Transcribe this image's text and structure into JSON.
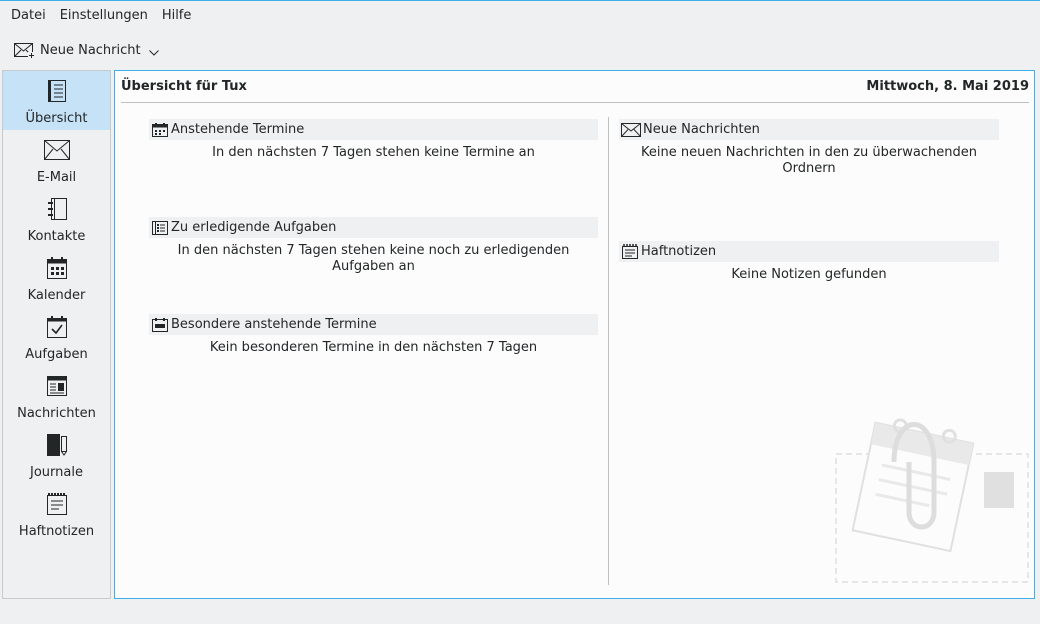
{
  "menubar": {
    "items": [
      "Datei",
      "Einstellungen",
      "Hilfe"
    ]
  },
  "toolbar": {
    "new_message": {
      "label": "Neue Nachricht",
      "icon": "mail-new-icon"
    }
  },
  "sidebar": {
    "items": [
      {
        "label": "Übersicht",
        "icon": "summary-icon",
        "active": true
      },
      {
        "label": "E-Mail",
        "icon": "envelope-icon"
      },
      {
        "label": "Kontakte",
        "icon": "address-book-icon"
      },
      {
        "label": "Kalender",
        "icon": "calendar-icon"
      },
      {
        "label": "Aufgaben",
        "icon": "task-checkbox-icon"
      },
      {
        "label": "Nachrichten",
        "icon": "newspaper-icon"
      },
      {
        "label": "Journale",
        "icon": "journal-icon"
      },
      {
        "label": "Haftnotizen",
        "icon": "sticky-note-icon"
      }
    ]
  },
  "main": {
    "title": "Übersicht für Tux",
    "date": "Mittwoch, 8. Mai 2019",
    "left": [
      {
        "heading": "Anstehende Termine",
        "text": "In den nächsten 7 Tagen stehen keine Termine an",
        "icon": "calendar-icon"
      },
      {
        "heading": "Zu erledigende Aufgaben",
        "text": "In den nächsten 7 Tagen stehen keine noch zu erledigenden Aufgaben an",
        "icon": "task-list-icon"
      },
      {
        "heading": "Besondere anstehende Termine",
        "text": "Kein besonderen Termine in den nächsten 7 Tagen",
        "icon": "special-dates-icon"
      }
    ],
    "right": [
      {
        "heading": "Neue Nachrichten",
        "text": "Keine neuen Nachrichten in den zu überwachenden Ordnern",
        "icon": "envelope-icon"
      },
      {
        "heading": "Haftnotizen",
        "text": "Keine Notizen gefunden",
        "icon": "sticky-note-icon"
      }
    ]
  },
  "colors": {
    "accent": "#3daee9",
    "selection": "#c6e2f7",
    "window": "#eff0f1",
    "view": "#fcfcfc",
    "text": "#232627"
  }
}
